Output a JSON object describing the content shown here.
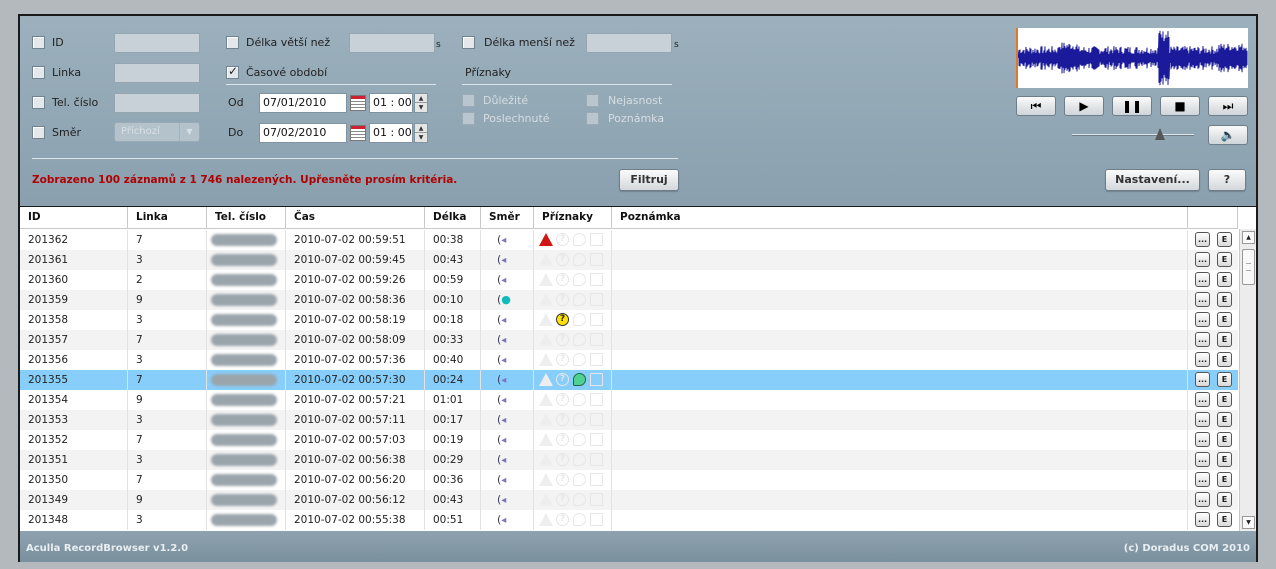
{
  "filters": {
    "id_label": "ID",
    "line_label": "Linka",
    "phone_label": "Tel. číslo",
    "direction_label": "Směr",
    "direction_select": "Příchozí",
    "length_gt_label": "Délka větší než",
    "length_lt_label": "Délka menší než",
    "seconds_unit": "s",
    "period_label": "Časové období",
    "from_label": "Od",
    "to_label": "Do",
    "from_date": "07/01/2010",
    "from_time": "01 : 00",
    "to_date": "07/02/2010",
    "to_time": "01 : 00",
    "flags_title": "Příznaky",
    "flag_important": "Důležité",
    "flag_unclear": "Nejasnost",
    "flag_listened": "Poslechnuté",
    "flag_note": "Poznámka",
    "period_checked": true
  },
  "status_message": "Zobrazeno 100 záznamů z 1 746 nalezených. Upřesněte prosím kritéria.",
  "buttons": {
    "filter": "Filtruj",
    "settings": "Nastavení...",
    "help": "?",
    "row_details": "...",
    "row_edit": "E"
  },
  "player": {
    "volume_level": 0.72
  },
  "table": {
    "columns": [
      "ID",
      "Linka",
      "Tel. číslo",
      "Čas",
      "Délka",
      "Směr",
      "Příznaky",
      "Poznámka"
    ],
    "selected_id": "201355",
    "rows": [
      {
        "id": "201362",
        "line": "7",
        "time": "2010-07-02 00:59:51",
        "length": "00:38",
        "dir": "out",
        "flags": {
          "important": true
        }
      },
      {
        "id": "201361",
        "line": "3",
        "time": "2010-07-02 00:59:45",
        "length": "00:43",
        "dir": "out",
        "flags": {}
      },
      {
        "id": "201360",
        "line": "2",
        "time": "2010-07-02 00:59:26",
        "length": "00:59",
        "dir": "out",
        "flags": {}
      },
      {
        "id": "201359",
        "line": "9",
        "time": "2010-07-02 00:58:36",
        "length": "00:10",
        "dir": "in",
        "flags": {}
      },
      {
        "id": "201358",
        "line": "3",
        "time": "2010-07-02 00:58:19",
        "length": "00:18",
        "dir": "out",
        "flags": {
          "unclear": true
        }
      },
      {
        "id": "201357",
        "line": "7",
        "time": "2010-07-02 00:58:09",
        "length": "00:33",
        "dir": "out",
        "flags": {}
      },
      {
        "id": "201356",
        "line": "3",
        "time": "2010-07-02 00:57:36",
        "length": "00:40",
        "dir": "out",
        "flags": {}
      },
      {
        "id": "201355",
        "line": "7",
        "time": "2010-07-02 00:57:30",
        "length": "00:24",
        "dir": "out",
        "flags": {
          "listened": true
        }
      },
      {
        "id": "201354",
        "line": "9",
        "time": "2010-07-02 00:57:21",
        "length": "01:01",
        "dir": "out",
        "flags": {}
      },
      {
        "id": "201353",
        "line": "3",
        "time": "2010-07-02 00:57:11",
        "length": "00:17",
        "dir": "out",
        "flags": {}
      },
      {
        "id": "201352",
        "line": "7",
        "time": "2010-07-02 00:57:03",
        "length": "00:19",
        "dir": "out",
        "flags": {}
      },
      {
        "id": "201351",
        "line": "3",
        "time": "2010-07-02 00:56:38",
        "length": "00:29",
        "dir": "out",
        "flags": {}
      },
      {
        "id": "201350",
        "line": "7",
        "time": "2010-07-02 00:56:20",
        "length": "00:36",
        "dir": "out",
        "flags": {}
      },
      {
        "id": "201349",
        "line": "9",
        "time": "2010-07-02 00:56:12",
        "length": "00:43",
        "dir": "out",
        "flags": {}
      },
      {
        "id": "201348",
        "line": "3",
        "time": "2010-07-02 00:55:38",
        "length": "00:51",
        "dir": "out",
        "flags": {}
      }
    ]
  },
  "footer": {
    "app_name": "Aculla RecordBrowser v1.2.0",
    "copyright": "(c) Doradus COM 2010"
  },
  "colors": {
    "panel": "#8ea2af",
    "selected_row": "#87cefa",
    "status_text": "#b00000",
    "waveform": "#1a1a9a"
  }
}
